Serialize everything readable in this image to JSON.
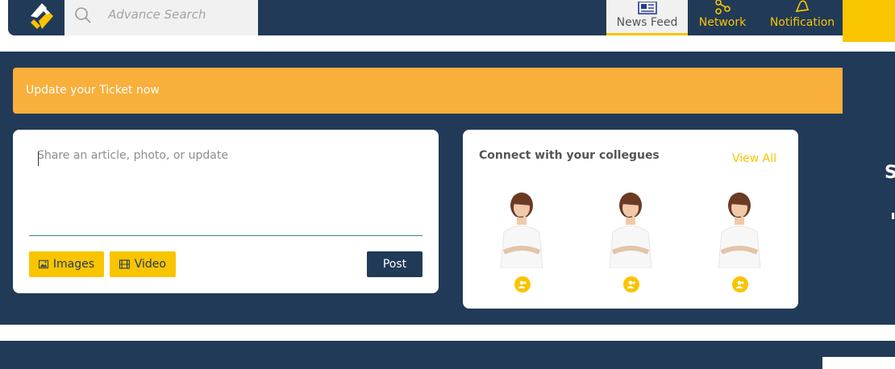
{
  "header": {
    "search": {
      "placeholder": "Advance Search"
    },
    "nav": [
      {
        "label": "News Feed",
        "icon": "newspaper-icon",
        "active": true
      },
      {
        "label": "Network",
        "icon": "share-icon"
      },
      {
        "label": "Notification",
        "icon": "bell-icon"
      }
    ]
  },
  "banner": {
    "text": "Update your Ticket now"
  },
  "post": {
    "placeholder": "Share an article, photo, or update",
    "images_label": "Images",
    "video_label": "Video",
    "post_label": "Post"
  },
  "connect": {
    "title": "Connect with your collegues",
    "view_all": "View All",
    "people": [
      {
        "icon": "add-user-icon"
      },
      {
        "icon": "add-user-icon"
      },
      {
        "icon": "add-user-icon"
      }
    ]
  },
  "edge": {
    "glyph": "S"
  },
  "colors": {
    "navy": "#213a57",
    "accent_yellow": "#f9c400",
    "banner_orange": "#f8af3b"
  }
}
